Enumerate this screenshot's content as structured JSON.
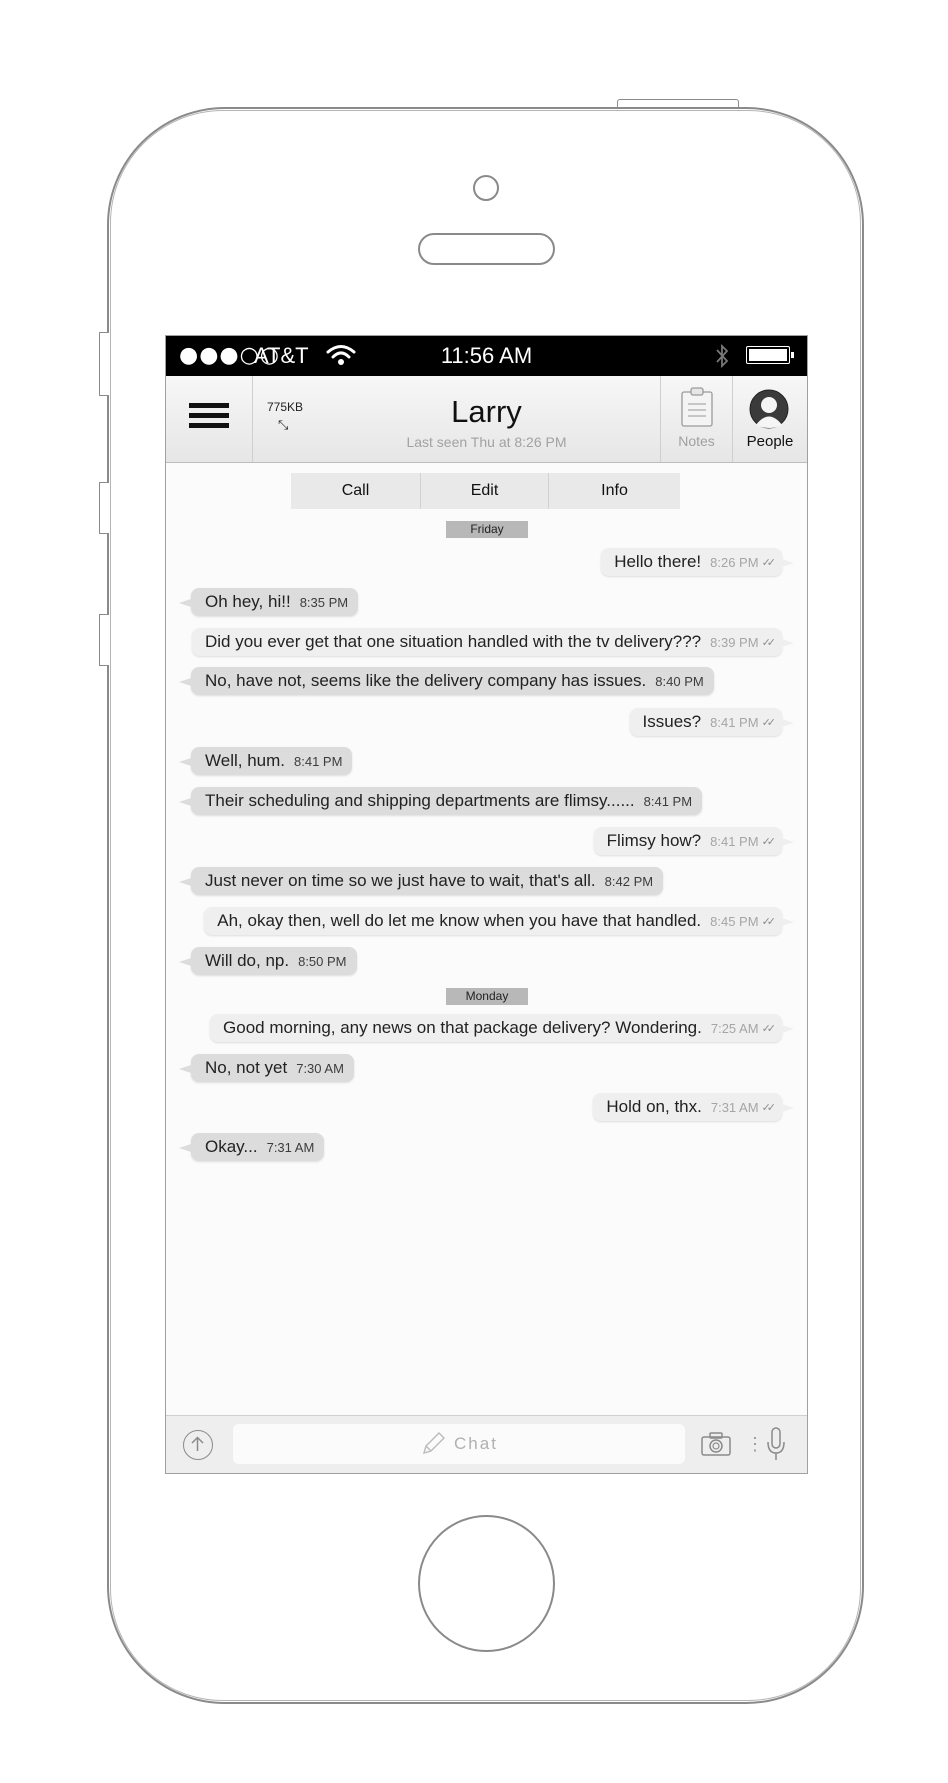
{
  "status_bar": {
    "signal": "●●●○○",
    "carrier": "AT&T",
    "time": "11:56 AM",
    "wifi_icon": "wifi-icon",
    "bluetooth_icon": "bluetooth-icon",
    "battery_level": 1.0
  },
  "header": {
    "menu_icon": "hamburger-icon",
    "data_size": "775KB",
    "resize_icon": "⤡",
    "title": "Larry",
    "subtitle": "Last seen Thu at 8:26 PM",
    "notes_label": "Notes",
    "people_label": "People"
  },
  "actions": [
    "Call",
    "Edit",
    "Info"
  ],
  "days": [
    "Friday",
    "Monday"
  ],
  "messages": [
    {
      "dir": "out",
      "text": "Hello there!",
      "time": "8:26 PM",
      "checks": "✓✓"
    },
    {
      "dir": "in",
      "text": "Oh hey, hi!!",
      "time": "8:35 PM"
    },
    {
      "dir": "out",
      "text": "Did you ever get that one situation handled with the tv delivery???",
      "time": "8:39 PM",
      "checks": "✓✓"
    },
    {
      "dir": "in",
      "text": "No, have not, seems like the delivery company has issues.",
      "time": "8:40 PM"
    },
    {
      "dir": "out",
      "text": "Issues?",
      "time": "8:41 PM",
      "checks": "✓✓"
    },
    {
      "dir": "in",
      "text": "Well, hum.",
      "time": "8:41 PM"
    },
    {
      "dir": "in",
      "text": "Their scheduling and shipping departments are flimsy......",
      "time": "8:41 PM"
    },
    {
      "dir": "out",
      "text": "Flimsy how?",
      "time": "8:41 PM",
      "checks": "✓✓"
    },
    {
      "dir": "in",
      "text": "Just never on time so we just have to wait, that's all.",
      "time": "8:42 PM"
    },
    {
      "dir": "out",
      "text": "Ah, okay then, well do let me know when you have that handled.",
      "time": "8:45 PM",
      "checks": "✓✓"
    },
    {
      "dir": "in",
      "text": "Will do, np.",
      "time": "8:50 PM"
    },
    {
      "dir": "out",
      "text": "Good morning, any news on that package delivery? Wondering.",
      "time": "7:25 AM",
      "checks": "✓✓"
    },
    {
      "dir": "in",
      "text": "No, not yet",
      "time": "7:30 AM"
    },
    {
      "dir": "out",
      "text": "Hold on, thx.",
      "time": "7:31 AM",
      "checks": "✓✓"
    },
    {
      "dir": "in",
      "text": "Okay...",
      "time": "7:31 AM"
    }
  ],
  "composer": {
    "upload_icon": "arrow-up-circle-icon",
    "pencil_icon": "pencil-icon",
    "placeholder": "Chat",
    "camera_icon": "camera-icon",
    "separator": "⋮",
    "mic_icon": "microphone-icon"
  }
}
